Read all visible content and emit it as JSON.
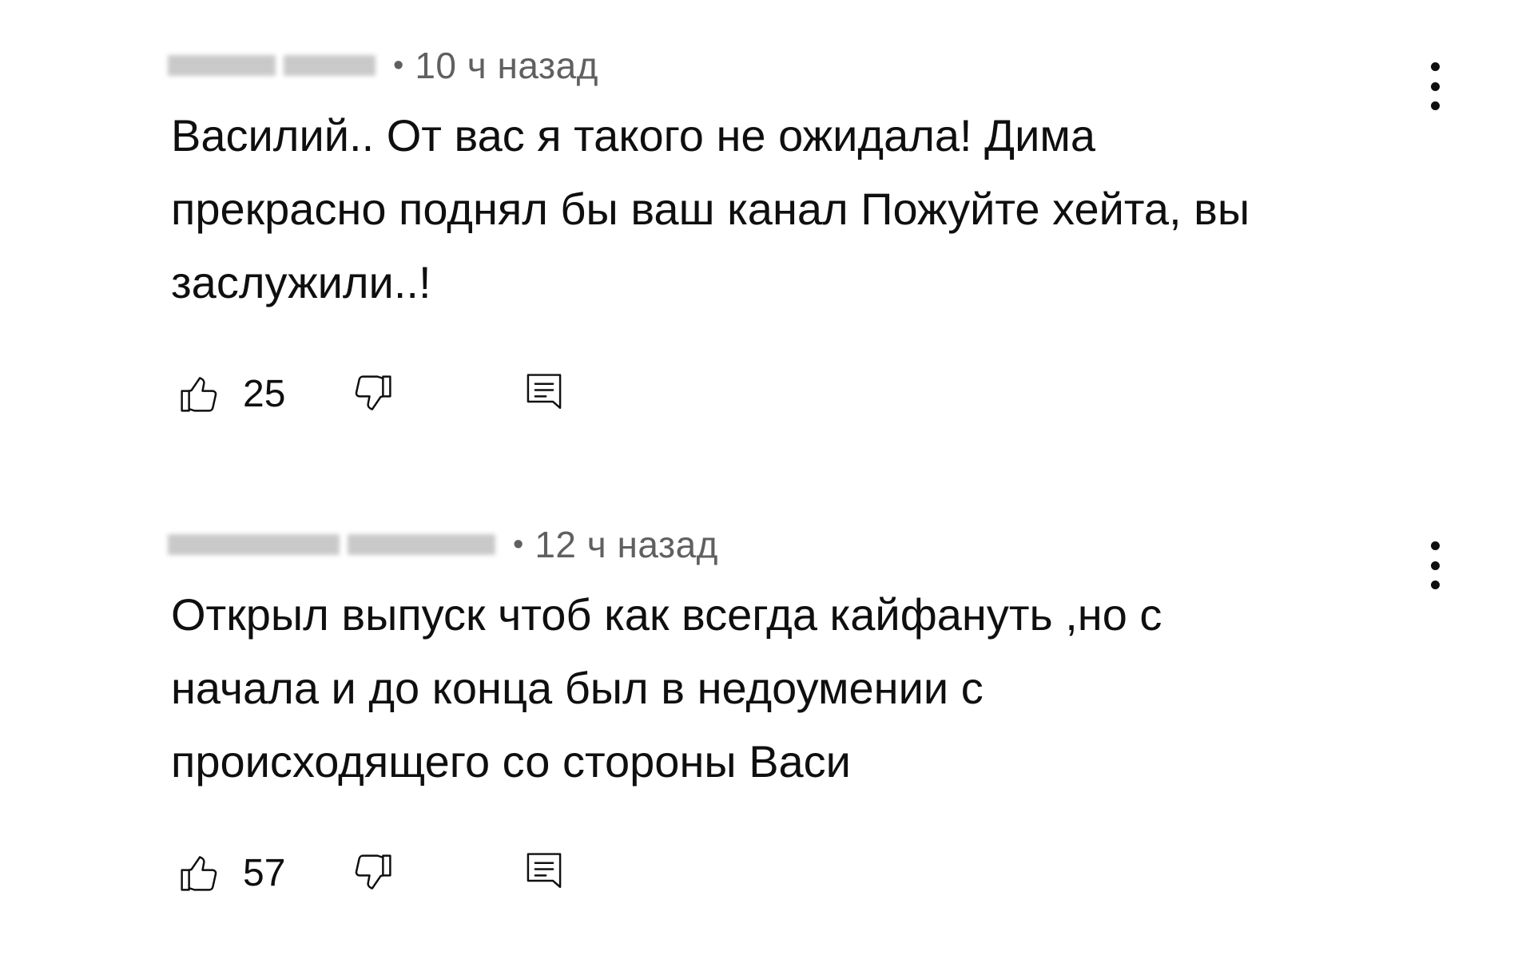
{
  "comments": [
    {
      "timestamp": "10 ч назад",
      "separator": "•",
      "text": "Василий.. От вас я такого не ожидала! Дима\nпрекрасно поднял бы ваш канал Пожуйте хейта, вы\nзаслужили..!",
      "likes": "25",
      "icons": {
        "like": "thumb-up-icon",
        "dislike": "thumb-down-icon",
        "reply": "reply-comment-icon",
        "menu": "more-vert-icon"
      }
    },
    {
      "timestamp": "12 ч назад",
      "separator": "•",
      "text": "Открыл выпуск чтоб как всегда кайфануть ,но с\nначала и до конца был в недоумении с\nпроисходящего со стороны Васи",
      "likes": "57",
      "icons": {
        "like": "thumb-up-icon",
        "dislike": "thumb-down-icon",
        "reply": "reply-comment-icon",
        "menu": "more-vert-icon"
      }
    }
  ],
  "colors": {
    "text": "#0f0f0f",
    "secondary_text": "#606060",
    "background": "#ffffff",
    "blurred_author": "#c9c9c9"
  }
}
